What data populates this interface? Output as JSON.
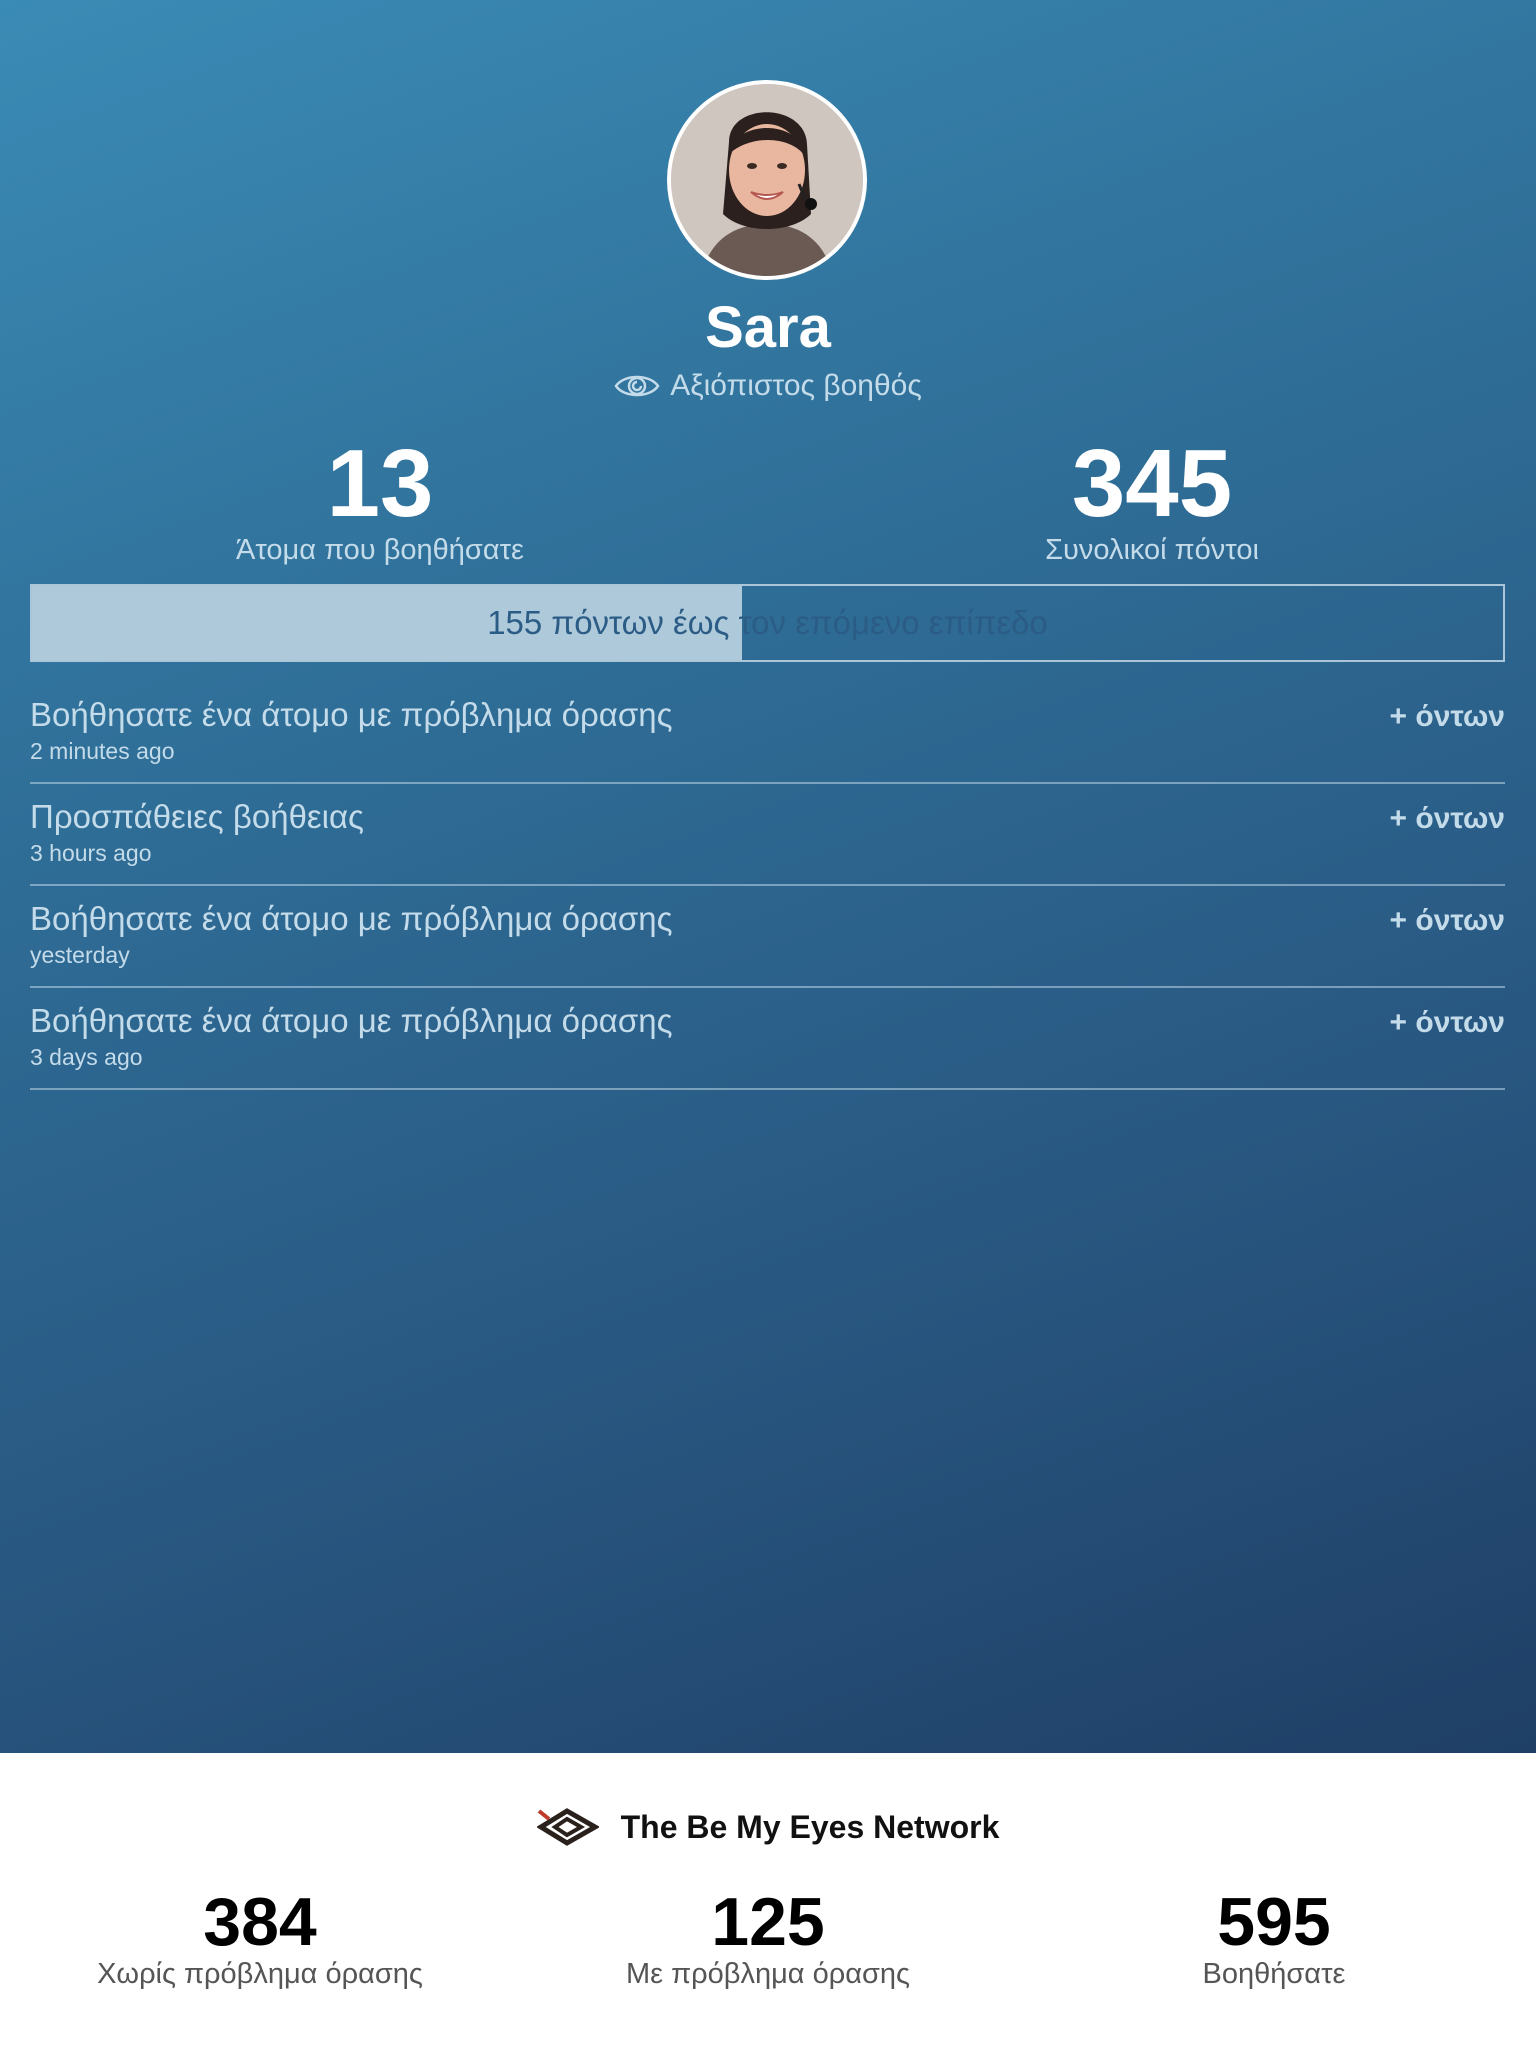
{
  "profile": {
    "name": "Sara",
    "role": "Αξιόπιστος βοηθός"
  },
  "stats": {
    "helped": {
      "value": "13",
      "label": "Άτομα που βοηθήσατε"
    },
    "points": {
      "value": "345",
      "label": "Συνολικοί πόντοι"
    }
  },
  "progress": {
    "text": "155 πόντων έως τον επόμενο επίπεδο",
    "fraction": 0.483
  },
  "activity": [
    {
      "title": "Βοήθησατε ένα άτομο με πρόβλημα όρασης",
      "time": "2 minutes ago",
      "points": "+ όντων"
    },
    {
      "title": "Προσπάθειες βοήθειας",
      "time": "3 hours ago",
      "points": "+ όντων"
    },
    {
      "title": "Βοήθησατε ένα άτομο με πρόβλημα όρασης",
      "time": "yesterday",
      "points": "+ όντων"
    },
    {
      "title": "Βοήθησατε ένα άτομο με πρόβλημα όρασης",
      "time": "3 days ago",
      "points": "+ όντων"
    }
  ],
  "network": {
    "title": "The Be My Eyes Network",
    "stats": [
      {
        "value": "384",
        "label": "Χωρίς πρόβλημα όρασης"
      },
      {
        "value": "125",
        "label": "Με πρόβλημα όρασης"
      },
      {
        "value": "595",
        "label": "Βοηθήσατε"
      }
    ]
  },
  "icons": {
    "role": "eye-icon",
    "network": "be-my-eyes-logo-icon"
  },
  "colors": {
    "gradient_start": "#3a8bb6",
    "gradient_end": "#1f3f66",
    "progress_fill": "#aec9da",
    "muted_text": "#c4dbea"
  }
}
